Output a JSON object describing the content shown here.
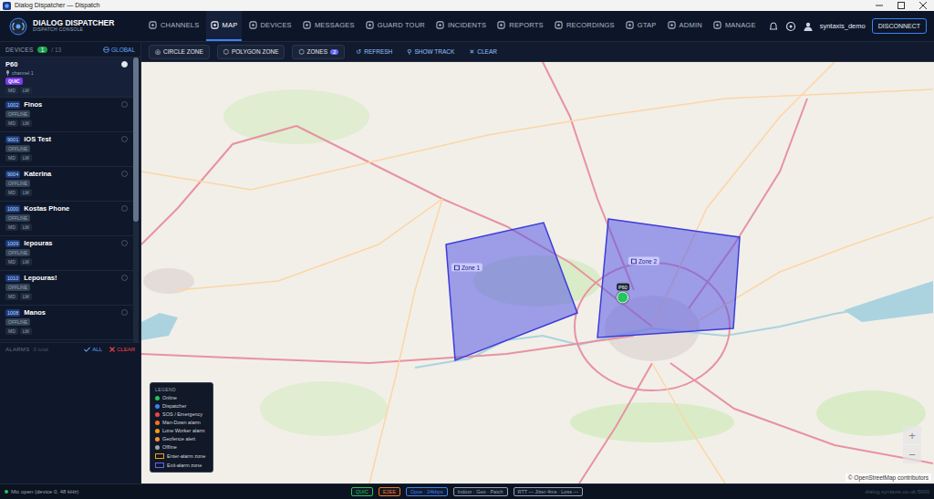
{
  "window": {
    "title": "Dialog Dispatcher — Dispatch"
  },
  "brand": {
    "title": "DIALOG DISPATCHER",
    "subtitle": "DISPATCH CONSOLE"
  },
  "nav": [
    {
      "label": "CHANNELS",
      "selected": false
    },
    {
      "label": "MAP",
      "selected": true
    },
    {
      "label": "DEVICES",
      "selected": false
    },
    {
      "label": "MESSAGES",
      "selected": false
    },
    {
      "label": "GUARD TOUR",
      "selected": false
    },
    {
      "label": "INCIDENTS",
      "selected": false
    },
    {
      "label": "REPORTS",
      "selected": false
    },
    {
      "label": "RECORDINGS",
      "selected": false
    },
    {
      "label": "GTAP",
      "selected": false
    },
    {
      "label": "ADMIN",
      "selected": false
    },
    {
      "label": "MANAGE",
      "selected": false
    }
  ],
  "user": {
    "name": "syntaxis_demo",
    "action": "DISCONNECT"
  },
  "sidebar": {
    "title": "DEVICES",
    "online": "1",
    "total": "/ 13",
    "scope": "GLOBAL",
    "devices": [
      {
        "name": "P60",
        "channel": "channel 1",
        "status": "QUIC",
        "online": true,
        "selected": true,
        "tags": [
          "MD",
          "LW"
        ]
      },
      {
        "id": "1002",
        "name": "Finos",
        "status": "OFFLINE",
        "online": false,
        "selected": false,
        "tags": [
          "MD",
          "LW"
        ]
      },
      {
        "id": "9001",
        "name": "iOS Test",
        "status": "OFFLINE",
        "online": false,
        "selected": false,
        "tags": [
          "MD",
          "LW"
        ]
      },
      {
        "id": "9004",
        "name": "Katerina",
        "status": "OFFLINE",
        "online": false,
        "selected": false,
        "tags": [
          "MD",
          "LW"
        ]
      },
      {
        "id": "1000",
        "name": "Kostas Phone",
        "status": "OFFLINE",
        "online": false,
        "selected": false,
        "tags": [
          "MD",
          "LW"
        ]
      },
      {
        "id": "1009",
        "name": "lepouras",
        "status": "OFFLINE",
        "online": false,
        "selected": false,
        "tags": [
          "MD",
          "LW"
        ]
      },
      {
        "id": "1010",
        "name": "Lepouras!",
        "status": "OFFLINE",
        "online": false,
        "selected": false,
        "tags": [
          "MD",
          "LW"
        ]
      },
      {
        "id": "1008",
        "name": "Manos",
        "status": "OFFLINE",
        "online": false,
        "selected": false,
        "tags": [
          "MD",
          "LW"
        ]
      }
    ]
  },
  "alarms": {
    "title": "ALARMS",
    "count": "0 total",
    "all": "ALL",
    "clear": "CLEAR"
  },
  "toolbar": [
    {
      "label": "CIRCLE ZONE",
      "icon": "◎",
      "kind": "button"
    },
    {
      "label": "POLYGON ZONE",
      "icon": "⬡",
      "kind": "button"
    },
    {
      "label": "ZONES",
      "icon": "⬡",
      "count": "2",
      "kind": "counter"
    },
    {
      "label": "REFRESH",
      "icon": "↺",
      "kind": "link"
    },
    {
      "label": "SHOW TRACK",
      "icon": "⚲",
      "kind": "link"
    },
    {
      "label": "CLEAR",
      "icon": "✕",
      "kind": "link"
    }
  ],
  "map": {
    "zones": [
      {
        "label": "Zone 1"
      },
      {
        "label": "Zone 2"
      }
    ],
    "markers": [
      {
        "label": "P60",
        "color": "#22c55e"
      }
    ],
    "attribution": "© OpenStreetMap contributors",
    "zoom": [
      "+",
      "−"
    ]
  },
  "legend": {
    "title": "LEGEND",
    "items": [
      {
        "label": "Online",
        "color": "#22c55e",
        "kind": "dot"
      },
      {
        "label": "Dispatcher",
        "color": "#3b82f6",
        "kind": "dot"
      },
      {
        "label": "SOS / Emergency",
        "color": "#ef4444",
        "kind": "dot"
      },
      {
        "label": "Man-Down alarm",
        "color": "#f97316",
        "kind": "dot"
      },
      {
        "label": "Lone Worker alarm",
        "color": "#f59e0b",
        "kind": "dot"
      },
      {
        "label": "Geofence alert",
        "color": "#fb923c",
        "kind": "dot"
      },
      {
        "label": "Offline",
        "color": "#9ca3af",
        "kind": "dot"
      },
      {
        "label": "Enter-alarm zone",
        "color": "#f59e0b",
        "kind": "zone"
      },
      {
        "label": "Exit-alarm zone",
        "color": "#6366f1",
        "kind": "zone"
      }
    ]
  },
  "status_bar": {
    "mic": "Mic open (device 0, 48 kHz)",
    "mic_color": "#22c55e",
    "badges": [
      {
        "label": "QUIC",
        "color": "#22c55e"
      },
      {
        "label": "E2EE",
        "color": "#f97316"
      },
      {
        "label": "Opus · 24kbps",
        "color": "#3b82f6"
      },
      {
        "label": "Indoor · Geo · Patch",
        "color": "#94a3b8"
      },
      {
        "label": "RTT — Jitter 4ms · Loss —",
        "color": "#94a3b8"
      }
    ],
    "server": "dialog.syntaxis.co.uk:5000"
  }
}
